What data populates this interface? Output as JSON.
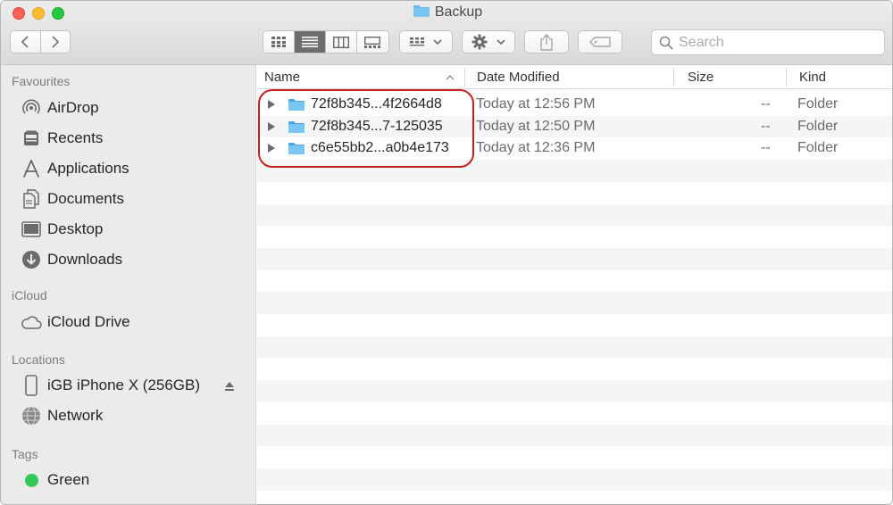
{
  "window": {
    "title": "Backup"
  },
  "toolbar": {
    "search_placeholder": "Search"
  },
  "sidebar": {
    "favourites_title": "Favourites",
    "favourites": [
      {
        "label": "AirDrop",
        "icon": "airdrop-icon"
      },
      {
        "label": "Recents",
        "icon": "recents-icon"
      },
      {
        "label": "Applications",
        "icon": "applications-icon"
      },
      {
        "label": "Documents",
        "icon": "documents-icon"
      },
      {
        "label": "Desktop",
        "icon": "desktop-icon"
      },
      {
        "label": "Downloads",
        "icon": "downloads-icon"
      }
    ],
    "icloud_title": "iCloud",
    "icloud": [
      {
        "label": "iCloud Drive",
        "icon": "cloud-icon"
      }
    ],
    "locations_title": "Locations",
    "locations": [
      {
        "label": "iGB iPhone X (256GB)",
        "icon": "iphone-icon"
      },
      {
        "label": "Network",
        "icon": "network-globe-icon"
      }
    ],
    "tags_title": "Tags",
    "tags": [
      {
        "label": "Green",
        "color": "#34c759"
      }
    ]
  },
  "columns": {
    "name": "Name",
    "date": "Date Modified",
    "size": "Size",
    "kind": "Kind"
  },
  "files": [
    {
      "name": "72f8b345...4f2664d8",
      "date": "Today at 12:56 PM",
      "size": "--",
      "kind": "Folder"
    },
    {
      "name": "72f8b345...7-125035",
      "date": "Today at 12:50 PM",
      "size": "--",
      "kind": "Folder"
    },
    {
      "name": "c6e55bb2...a0b4e173",
      "date": "Today at 12:36 PM",
      "size": "--",
      "kind": "Folder"
    }
  ],
  "colors": {
    "folder": "#62b8ee",
    "highlight": "#c81e1e",
    "accent_active_segment": "#6e6e6e"
  }
}
